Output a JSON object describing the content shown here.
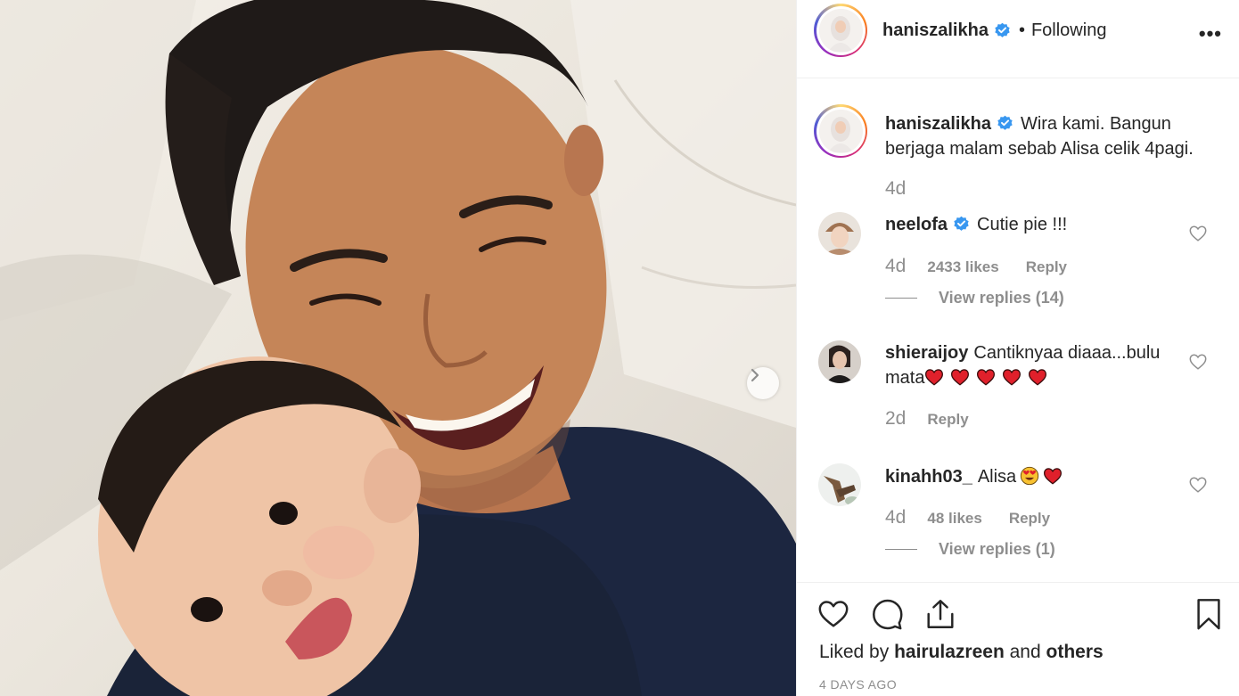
{
  "post": {
    "author": "haniszalikha",
    "separator": "•",
    "follow_status": "Following",
    "more_label": "•••",
    "caption": "Wira kami. Bangun berjaga malam sebab Alisa celik 4pagi.",
    "caption_time": "4d"
  },
  "comments": [
    {
      "username": "neelofa",
      "verified": true,
      "text": "Cutie pie !!!",
      "time": "4d",
      "likes": "2433 likes",
      "reply": "Reply",
      "view_replies": "View replies (14)"
    },
    {
      "username": "shieraijoy",
      "verified": false,
      "text": "Cantiknyaa diaaa...bulu mata",
      "emojis": [
        "red-heart",
        "red-heart",
        "red-heart",
        "red-heart",
        "red-heart"
      ],
      "time": "2d",
      "reply": "Reply"
    },
    {
      "username": "kinahh03_",
      "verified": false,
      "text": "Alisa",
      "emojis": [
        "heart-eyes",
        "red-heart"
      ],
      "time": "4d",
      "likes": "48 likes",
      "reply": "Reply",
      "view_replies": "View replies (1)"
    }
  ],
  "footer": {
    "liked_prefix": "Liked by",
    "liked_user": "hairulazreen",
    "liked_and": "and",
    "liked_others": "others",
    "date": "4 DAYS AGO"
  },
  "colors": {
    "text": "#262626",
    "muted": "#8e8e8e",
    "verified": "#3897f0",
    "heart": "#ed4956",
    "border": "#efefef"
  },
  "icons": [
    "verified-badge-icon",
    "more-options-icon",
    "next-arrow-icon",
    "heart-outline-icon",
    "comment-icon",
    "share-icon",
    "bookmark-icon",
    "red-heart-emoji",
    "heart-eyes-emoji"
  ]
}
